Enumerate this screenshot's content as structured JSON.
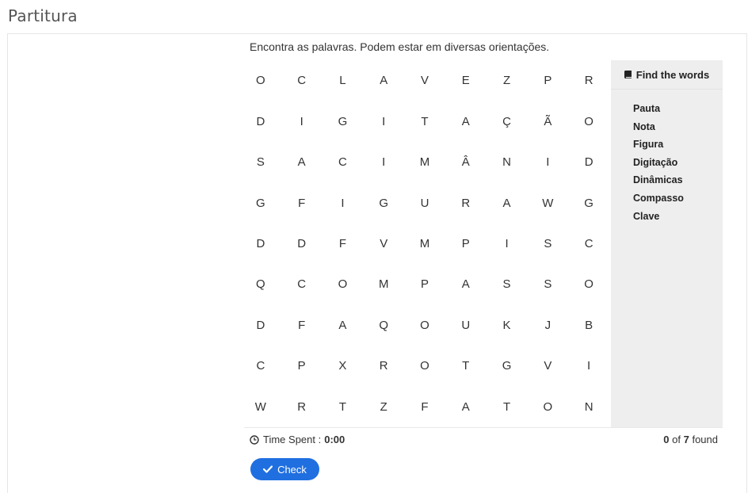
{
  "page": {
    "title": "Partitura"
  },
  "puzzle": {
    "instructions": "Encontra as palavras. Podem estar em diversas orientações.",
    "grid": [
      [
        "O",
        "C",
        "L",
        "A",
        "V",
        "E",
        "Z",
        "P",
        "R"
      ],
      [
        "D",
        "I",
        "G",
        "I",
        "T",
        "A",
        "Ç",
        "Ã",
        "O"
      ],
      [
        "S",
        "A",
        "C",
        "I",
        "M",
        "Â",
        "N",
        "I",
        "D"
      ],
      [
        "G",
        "F",
        "I",
        "G",
        "U",
        "R",
        "A",
        "W",
        "G"
      ],
      [
        "D",
        "D",
        "F",
        "V",
        "M",
        "P",
        "I",
        "S",
        "C"
      ],
      [
        "Q",
        "C",
        "O",
        "M",
        "P",
        "A",
        "S",
        "S",
        "O"
      ],
      [
        "D",
        "F",
        "A",
        "Q",
        "O",
        "U",
        "K",
        "J",
        "B"
      ],
      [
        "C",
        "P",
        "X",
        "R",
        "O",
        "T",
        "G",
        "V",
        "I"
      ],
      [
        "W",
        "R",
        "T",
        "Z",
        "F",
        "A",
        "T",
        "O",
        "N"
      ]
    ]
  },
  "sidebar": {
    "header": "Find the words",
    "words": [
      "Pauta",
      "Nota",
      "Figura",
      "Digitação",
      "Dinâmicas",
      "Compasso",
      "Clave"
    ]
  },
  "footer": {
    "time_label": "Time Spent :",
    "time_value": "0:00",
    "found_count": "0",
    "found_of": "of",
    "found_total": "7",
    "found_label": "found"
  },
  "actions": {
    "check_label": "Check"
  },
  "colors": {
    "accent": "#1f6fe0",
    "sidebar_bg": "#eeeeee"
  }
}
